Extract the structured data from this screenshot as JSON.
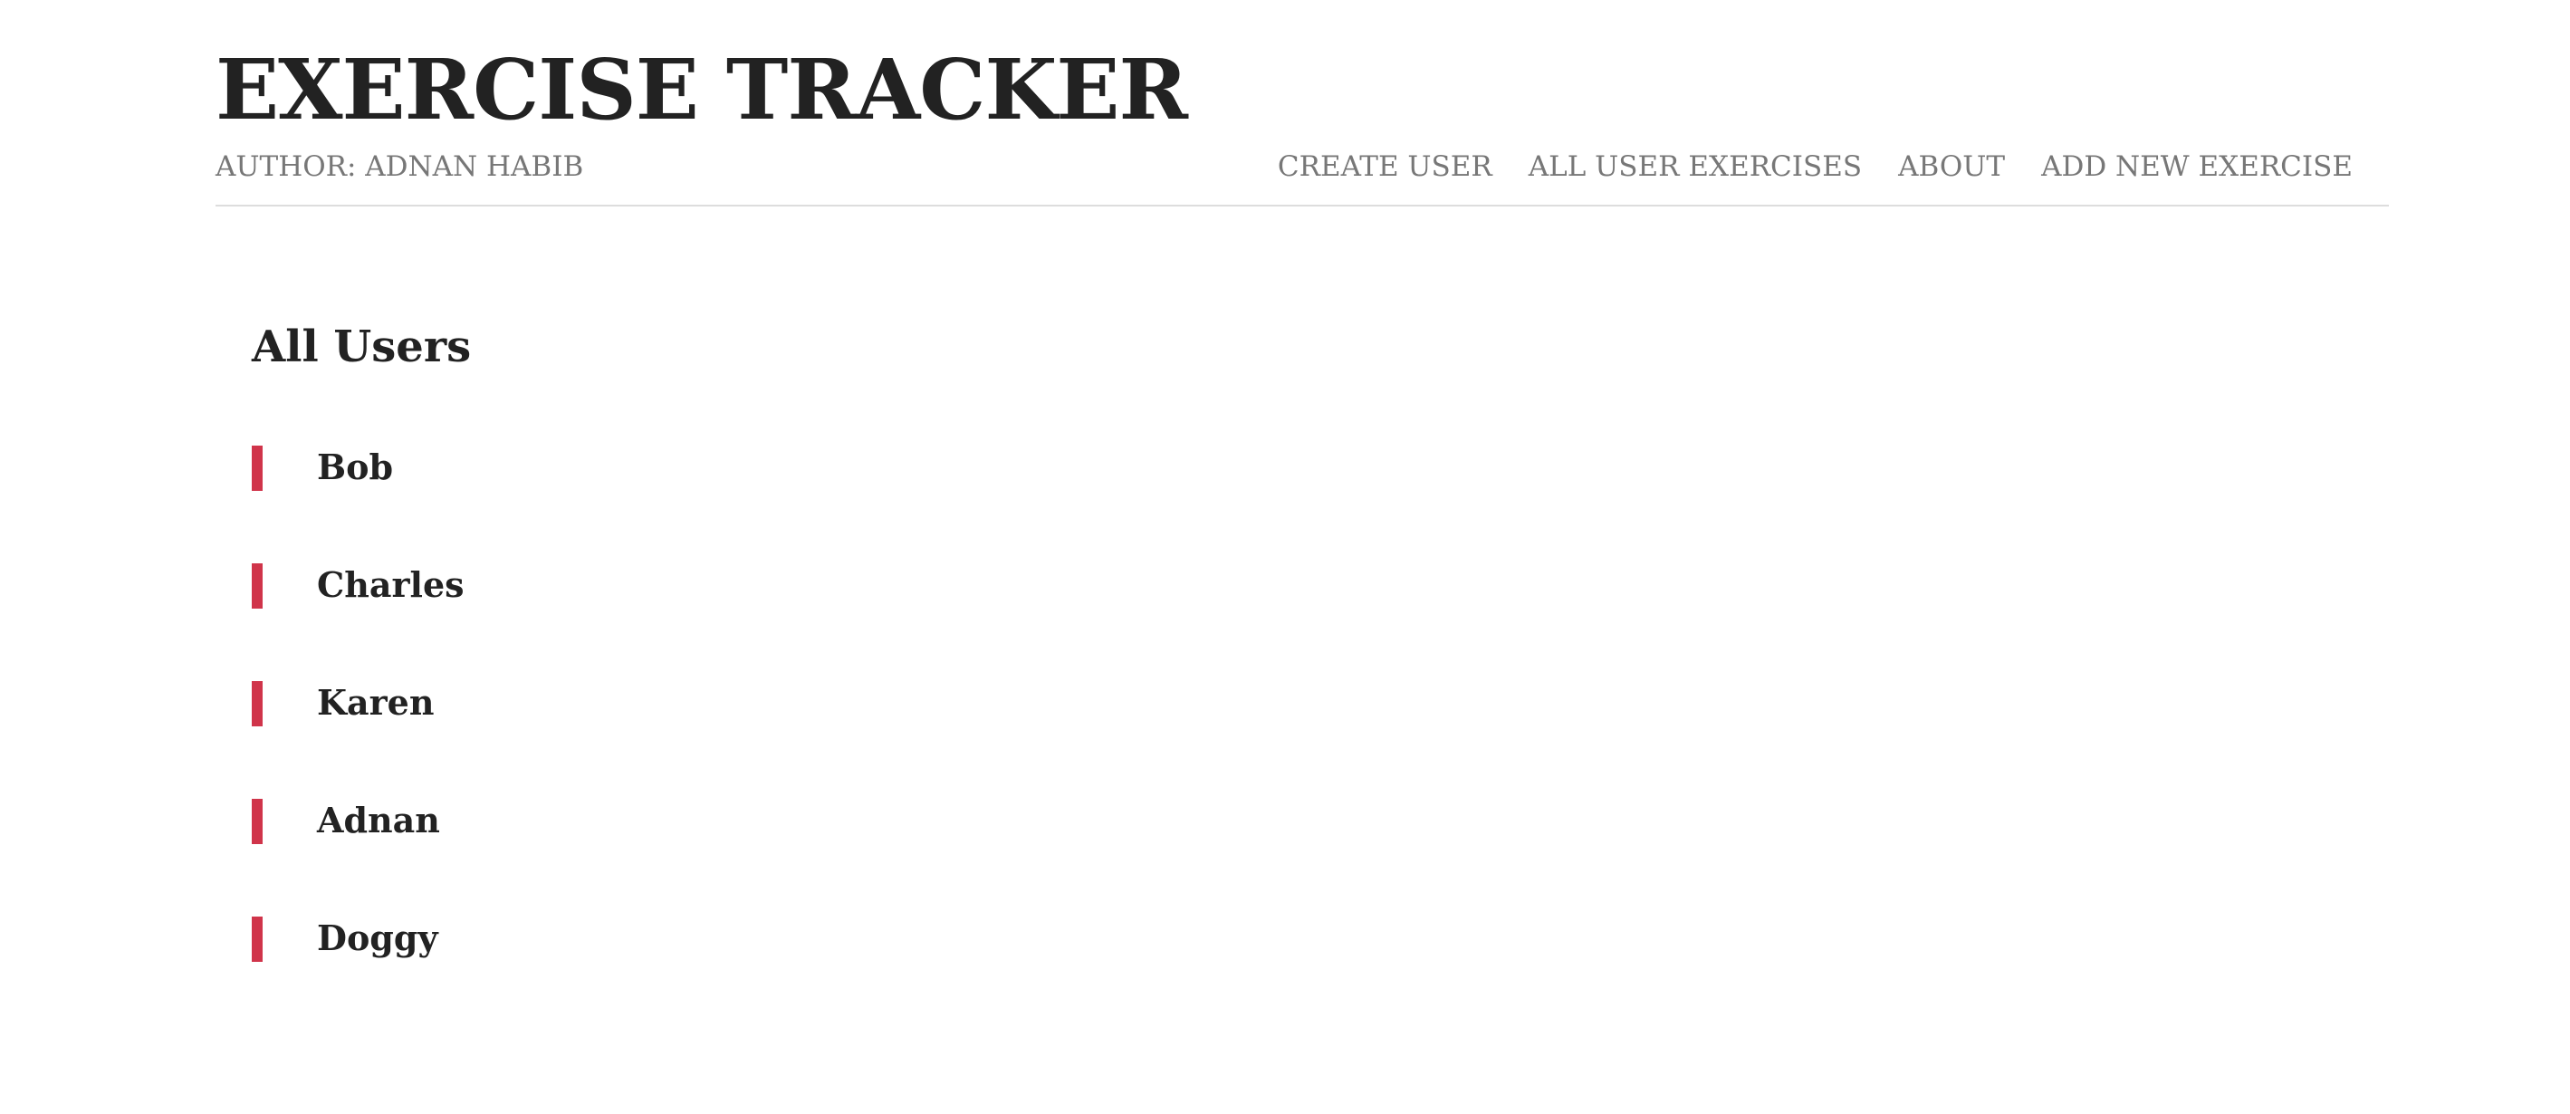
{
  "header": {
    "title": "EXERCISE TRACKER",
    "author": "AUTHOR: ADNAN HABIB"
  },
  "nav": {
    "items": [
      {
        "label": "CREATE USER"
      },
      {
        "label": "ALL USER EXERCISES"
      },
      {
        "label": "ABOUT"
      },
      {
        "label": "ADD NEW EXERCISE"
      }
    ]
  },
  "main": {
    "title": "All Users",
    "users": [
      {
        "name": "Bob"
      },
      {
        "name": "Charles"
      },
      {
        "name": "Karen"
      },
      {
        "name": "Adnan"
      },
      {
        "name": "Doggy"
      }
    ]
  },
  "colors": {
    "accent": "#d0344a",
    "text": "#222222",
    "muted": "#777777",
    "divider": "#dddddd"
  }
}
